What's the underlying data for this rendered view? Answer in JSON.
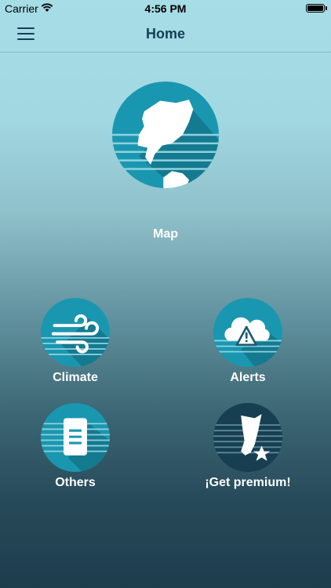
{
  "status_bar": {
    "carrier": "Carrier",
    "time": "4:56 PM"
  },
  "nav": {
    "title": "Home",
    "menu_icon": "hamburger-menu-icon"
  },
  "tiles": [
    {
      "label": "Map",
      "icon": "island-map-icon"
    },
    {
      "label": "Climate",
      "icon": "wind-icon"
    },
    {
      "label": "Alerts",
      "icon": "cloud-alert-icon"
    },
    {
      "label": "Others",
      "icon": "document-icon"
    },
    {
      "label": "¡Get premium!",
      "icon": "premium-star-icon"
    }
  ],
  "colors": {
    "tile_blue": "#1a97b0",
    "tile_dark": "#173e51",
    "title": "#123f57"
  }
}
